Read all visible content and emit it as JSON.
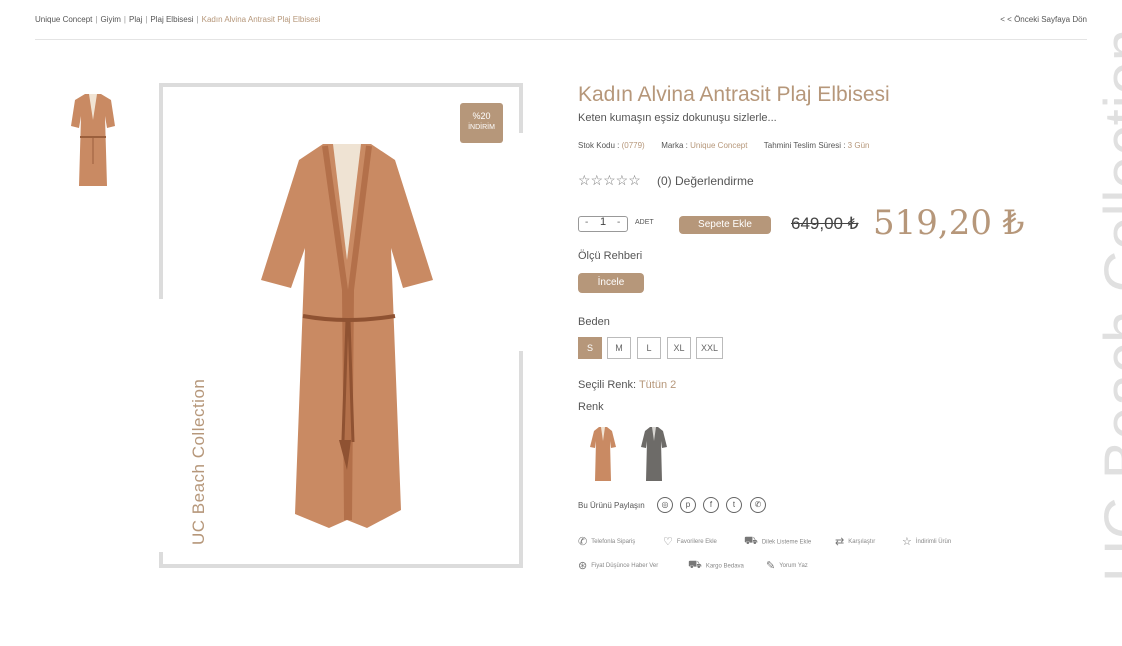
{
  "breadcrumb": {
    "items": [
      "Unique Concept",
      "Giyim",
      "Plaj",
      "Plaj Elbisesi"
    ],
    "current": "Kadın Alvina Antrasit Plaj Elbisesi",
    "separator": "|"
  },
  "back_link": "< < Önceki Sayfaya Dön",
  "gallery": {
    "side_text": "UC Beach Collection",
    "badge_percent": "%20",
    "badge_label": "İNDİRİM"
  },
  "product": {
    "title": "Kadın Alvina Antrasit Plaj Elbisesi",
    "subtitle": "Keten kumaşın eşsiz dokunuşu sizlerle...",
    "stock_label": "Stok Kodu :",
    "stock_value": "(0779)",
    "brand_label": "Marka :",
    "brand_value": "Unique Concept",
    "delivery_label": "Tahmini Teslim Süresi :",
    "delivery_value": "3 Gün",
    "stars": "☆☆☆☆☆",
    "rating_text": "(0) Değerlendirme",
    "rating_value": 0,
    "qty_minus": "-",
    "qty_value": "1",
    "qty_plus": "-",
    "qty_unit": "ADET",
    "add_to_cart": "Sepete Ekle",
    "old_price": "649,00 ₺",
    "new_price": "519,20 ₺",
    "size_guide": "Ölçü Rehberi",
    "inspect": "İncele",
    "size_label": "Beden",
    "sizes": [
      "S",
      "M",
      "L",
      "XL",
      "XXL"
    ],
    "selected_size": "S",
    "selected_color_label": "Seçili Renk:",
    "selected_color_value": "Tütün 2",
    "color_label": "Renk",
    "share_label": "Bu Ürünü Paylaşın"
  },
  "actions": [
    {
      "label": "Telefonla Sipariş",
      "icon": "phone-icon"
    },
    {
      "label": "Favorilere Ekle",
      "icon": "heart-icon"
    },
    {
      "label": "Dilek Listeme Ekle",
      "icon": "cart-icon"
    },
    {
      "label": "Karşılaştır",
      "icon": "compare-icon"
    },
    {
      "label": "İndirimli Ürün",
      "icon": "star-icon"
    },
    {
      "label": "Fiyat Düşünce Haber Ver",
      "icon": "price-tag-icon"
    },
    {
      "label": "Kargo Bedava",
      "icon": "truck-icon"
    },
    {
      "label": "Yorum Yaz",
      "icon": "pen-icon"
    }
  ],
  "side_banner": "UC Beach Collection",
  "colors": {
    "accent": "#b6977a",
    "dress_tan": "#c98a63",
    "dress_grey": "#6d6b68"
  }
}
